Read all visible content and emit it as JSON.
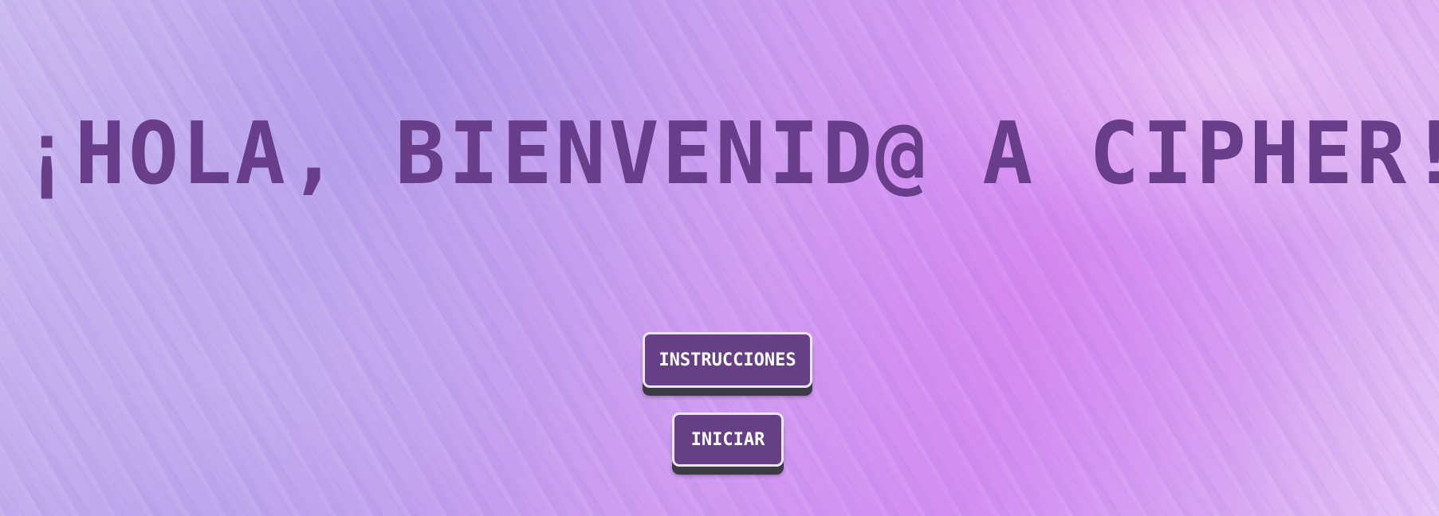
{
  "heading": {
    "title": "¡HOLA, BIENVENID@ A CIPHER!"
  },
  "menu": {
    "instructions_label": "INSTRUCCIONES",
    "start_label": "INICIAR"
  },
  "colors": {
    "title": "#683e8a",
    "button_bg": "#673f87",
    "button_border": "#e9e6ee",
    "button_text": "#ffffff",
    "button_shadow": "#3c3a44"
  }
}
